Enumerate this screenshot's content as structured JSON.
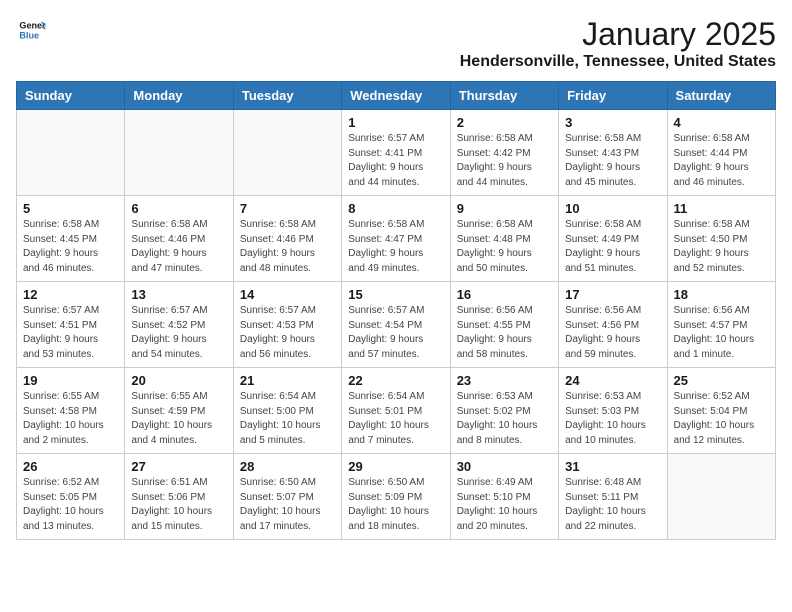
{
  "header": {
    "logo_line1": "General",
    "logo_line2": "Blue",
    "month": "January 2025",
    "location": "Hendersonville, Tennessee, United States"
  },
  "weekdays": [
    "Sunday",
    "Monday",
    "Tuesday",
    "Wednesday",
    "Thursday",
    "Friday",
    "Saturday"
  ],
  "weeks": [
    [
      {
        "day": "",
        "info": ""
      },
      {
        "day": "",
        "info": ""
      },
      {
        "day": "",
        "info": ""
      },
      {
        "day": "1",
        "info": "Sunrise: 6:57 AM\nSunset: 4:41 PM\nDaylight: 9 hours\nand 44 minutes."
      },
      {
        "day": "2",
        "info": "Sunrise: 6:58 AM\nSunset: 4:42 PM\nDaylight: 9 hours\nand 44 minutes."
      },
      {
        "day": "3",
        "info": "Sunrise: 6:58 AM\nSunset: 4:43 PM\nDaylight: 9 hours\nand 45 minutes."
      },
      {
        "day": "4",
        "info": "Sunrise: 6:58 AM\nSunset: 4:44 PM\nDaylight: 9 hours\nand 46 minutes."
      }
    ],
    [
      {
        "day": "5",
        "info": "Sunrise: 6:58 AM\nSunset: 4:45 PM\nDaylight: 9 hours\nand 46 minutes."
      },
      {
        "day": "6",
        "info": "Sunrise: 6:58 AM\nSunset: 4:46 PM\nDaylight: 9 hours\nand 47 minutes."
      },
      {
        "day": "7",
        "info": "Sunrise: 6:58 AM\nSunset: 4:46 PM\nDaylight: 9 hours\nand 48 minutes."
      },
      {
        "day": "8",
        "info": "Sunrise: 6:58 AM\nSunset: 4:47 PM\nDaylight: 9 hours\nand 49 minutes."
      },
      {
        "day": "9",
        "info": "Sunrise: 6:58 AM\nSunset: 4:48 PM\nDaylight: 9 hours\nand 50 minutes."
      },
      {
        "day": "10",
        "info": "Sunrise: 6:58 AM\nSunset: 4:49 PM\nDaylight: 9 hours\nand 51 minutes."
      },
      {
        "day": "11",
        "info": "Sunrise: 6:58 AM\nSunset: 4:50 PM\nDaylight: 9 hours\nand 52 minutes."
      }
    ],
    [
      {
        "day": "12",
        "info": "Sunrise: 6:57 AM\nSunset: 4:51 PM\nDaylight: 9 hours\nand 53 minutes."
      },
      {
        "day": "13",
        "info": "Sunrise: 6:57 AM\nSunset: 4:52 PM\nDaylight: 9 hours\nand 54 minutes."
      },
      {
        "day": "14",
        "info": "Sunrise: 6:57 AM\nSunset: 4:53 PM\nDaylight: 9 hours\nand 56 minutes."
      },
      {
        "day": "15",
        "info": "Sunrise: 6:57 AM\nSunset: 4:54 PM\nDaylight: 9 hours\nand 57 minutes."
      },
      {
        "day": "16",
        "info": "Sunrise: 6:56 AM\nSunset: 4:55 PM\nDaylight: 9 hours\nand 58 minutes."
      },
      {
        "day": "17",
        "info": "Sunrise: 6:56 AM\nSunset: 4:56 PM\nDaylight: 9 hours\nand 59 minutes."
      },
      {
        "day": "18",
        "info": "Sunrise: 6:56 AM\nSunset: 4:57 PM\nDaylight: 10 hours\nand 1 minute."
      }
    ],
    [
      {
        "day": "19",
        "info": "Sunrise: 6:55 AM\nSunset: 4:58 PM\nDaylight: 10 hours\nand 2 minutes."
      },
      {
        "day": "20",
        "info": "Sunrise: 6:55 AM\nSunset: 4:59 PM\nDaylight: 10 hours\nand 4 minutes."
      },
      {
        "day": "21",
        "info": "Sunrise: 6:54 AM\nSunset: 5:00 PM\nDaylight: 10 hours\nand 5 minutes."
      },
      {
        "day": "22",
        "info": "Sunrise: 6:54 AM\nSunset: 5:01 PM\nDaylight: 10 hours\nand 7 minutes."
      },
      {
        "day": "23",
        "info": "Sunrise: 6:53 AM\nSunset: 5:02 PM\nDaylight: 10 hours\nand 8 minutes."
      },
      {
        "day": "24",
        "info": "Sunrise: 6:53 AM\nSunset: 5:03 PM\nDaylight: 10 hours\nand 10 minutes."
      },
      {
        "day": "25",
        "info": "Sunrise: 6:52 AM\nSunset: 5:04 PM\nDaylight: 10 hours\nand 12 minutes."
      }
    ],
    [
      {
        "day": "26",
        "info": "Sunrise: 6:52 AM\nSunset: 5:05 PM\nDaylight: 10 hours\nand 13 minutes."
      },
      {
        "day": "27",
        "info": "Sunrise: 6:51 AM\nSunset: 5:06 PM\nDaylight: 10 hours\nand 15 minutes."
      },
      {
        "day": "28",
        "info": "Sunrise: 6:50 AM\nSunset: 5:07 PM\nDaylight: 10 hours\nand 17 minutes."
      },
      {
        "day": "29",
        "info": "Sunrise: 6:50 AM\nSunset: 5:09 PM\nDaylight: 10 hours\nand 18 minutes."
      },
      {
        "day": "30",
        "info": "Sunrise: 6:49 AM\nSunset: 5:10 PM\nDaylight: 10 hours\nand 20 minutes."
      },
      {
        "day": "31",
        "info": "Sunrise: 6:48 AM\nSunset: 5:11 PM\nDaylight: 10 hours\nand 22 minutes."
      },
      {
        "day": "",
        "info": ""
      }
    ]
  ]
}
